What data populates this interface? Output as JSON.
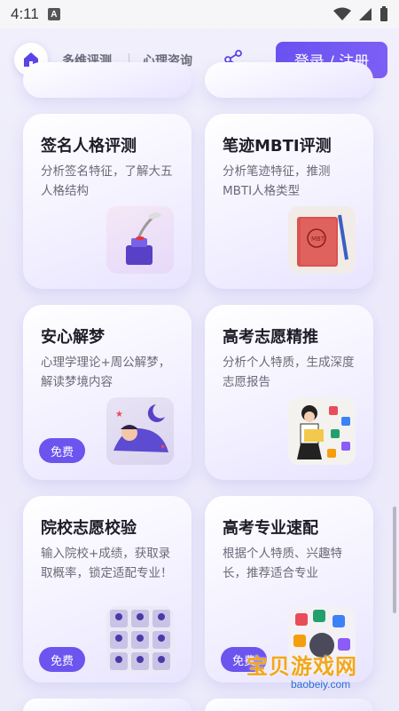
{
  "status": {
    "time": "4:11",
    "notif_icon": "A"
  },
  "nav": {
    "tab1": "多维评测",
    "tab2": "心理咨询",
    "login": "登录 / 注册"
  },
  "cards": [
    {
      "title": "签名人格评测",
      "desc": "分析签名特征，了解大五人格结构",
      "badge": ""
    },
    {
      "title": "笔迹MBTI评测",
      "desc": "分析笔迹特征，推测MBTI人格类型",
      "badge": ""
    },
    {
      "title": "安心解梦",
      "desc": "心理学理论+周公解梦，解读梦境内容",
      "badge": "免费"
    },
    {
      "title": "高考志愿精推",
      "desc": "分析个人特质，生成深度志愿报告",
      "badge": ""
    },
    {
      "title": "院校志愿校验",
      "desc": "输入院校+成绩，获取录取概率，锁定适配专业！",
      "badge": "免费"
    },
    {
      "title": "高考专业速配",
      "desc": "根据个人特质、兴趣特长，推荐适合专业",
      "badge": "免费"
    }
  ],
  "watermark": {
    "main": "宝贝游戏网",
    "sub": "baobeiy.com"
  },
  "colors": {
    "accent": "#6c54ee",
    "background": "#eceafa"
  }
}
